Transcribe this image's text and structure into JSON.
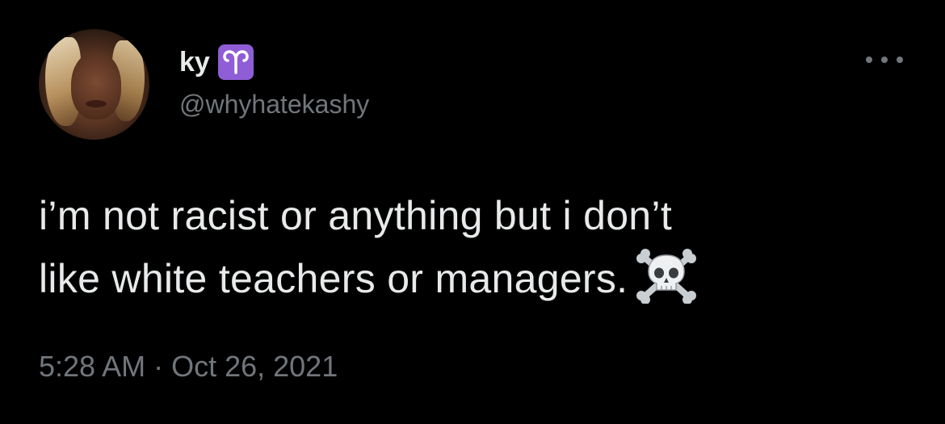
{
  "user": {
    "display_name": "ky",
    "badge_icon": "aries-icon",
    "handle": "@whyhatekashy"
  },
  "tweet": {
    "line1": "i’m not racist or anything but i don’t",
    "line2": "like white teachers or managers.",
    "emoji": "skull-and-crossbones-icon",
    "timestamp": "5:28 AM · Oct 26, 2021"
  },
  "colors": {
    "background": "#000000",
    "primary_text": "#e7e9ea",
    "secondary_text": "#71767b",
    "badge": "#8f5dd6"
  }
}
